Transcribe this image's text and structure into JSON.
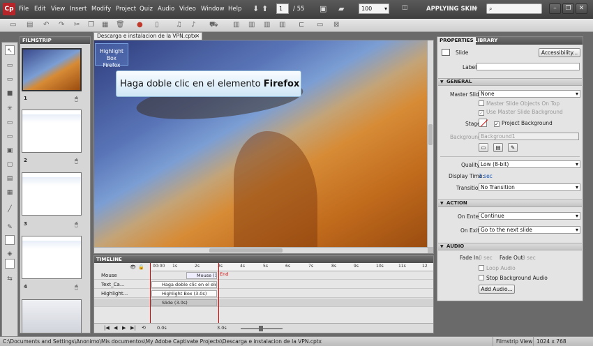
{
  "app": {
    "logo_text": "Cp"
  },
  "menu": [
    "File",
    "Edit",
    "View",
    "Insert",
    "Modify",
    "Project",
    "Quiz",
    "Audio",
    "Video",
    "Window",
    "Help"
  ],
  "nav": {
    "current_slide": "1",
    "total_slides": "/ 55",
    "zoom": "100",
    "workspace": "APPLYING SKIN",
    "search_placeholder": ""
  },
  "document": {
    "tab_title": "Descarga e instalacion de la VPN.cptx"
  },
  "stage": {
    "caption_prefix": "Haga doble clic en el elemento ",
    "caption_bold": "Firefox",
    "highlight_label": "Highlight Box",
    "icon_label": "Firefox"
  },
  "filmstrip": {
    "title": "FILMSTRIP",
    "slides": [
      "1",
      "2",
      "3",
      "4"
    ]
  },
  "timeline": {
    "title": "TIMELINE",
    "ruler": [
      "00:00",
      "1s",
      "2s",
      "3s",
      "4s",
      "5s",
      "6s",
      "7s",
      "8s",
      "9s",
      "10s",
      "11s",
      "12"
    ],
    "end_label": "End",
    "layers": [
      {
        "name": "Mouse",
        "bar": "Mouse (1.6..."
      },
      {
        "name": "Text_Ca...",
        "bar": "Haga doble clic en el eleme..."
      },
      {
        "name": "Highlight...",
        "bar": "Highlight Box (3.0s)"
      },
      {
        "name": "",
        "bar": "Slide (3.0s)"
      }
    ],
    "time_start": "0.0s",
    "time_total": "3.0s"
  },
  "properties": {
    "tabs": [
      "PROPERTIES",
      "LIBRARY"
    ],
    "object_type": "Slide",
    "accessibility_btn": "Accessibility...",
    "label_caption": "Label:",
    "label_value": "",
    "general": {
      "title": "GENERAL",
      "master_slide_label": "Master Slide:",
      "master_slide_value": "None",
      "chk_master_objects": "Master Slide Objects On Top",
      "chk_use_master_bg": "Use Master Slide Background",
      "stage_label": "Stage:",
      "chk_project_bg": "Project Background",
      "background_label": "Background:",
      "background_value": "Background1",
      "quality_label": "Quality:",
      "quality_value": "Low (8-bit)",
      "display_time_label": "Display Time:",
      "display_time_value": "3 sec",
      "transition_label": "Transition:",
      "transition_value": "No Transition"
    },
    "action": {
      "title": "ACTION",
      "on_enter_label": "On Enter:",
      "on_enter_value": "Continue",
      "on_exit_label": "On Exit:",
      "on_exit_value": "Go to the next slide"
    },
    "audio": {
      "title": "AUDIO",
      "fade_in_label": "Fade In:",
      "fade_in_value": "0 sec",
      "fade_out_label": "Fade Out:",
      "fade_out_value": "0 sec",
      "chk_loop": "Loop Audio",
      "chk_stop_bg": "Stop Background Audio",
      "add_audio_btn": "Add Audio..."
    }
  },
  "status": {
    "path": "C:\\Documents and Settings\\Anonimo\\Mis documentos\\My Adobe Captivate Projects\\Descarga e instalacion de la VPN.cptx",
    "view": "Filmstrip View",
    "resolution": "1024 x 768"
  }
}
